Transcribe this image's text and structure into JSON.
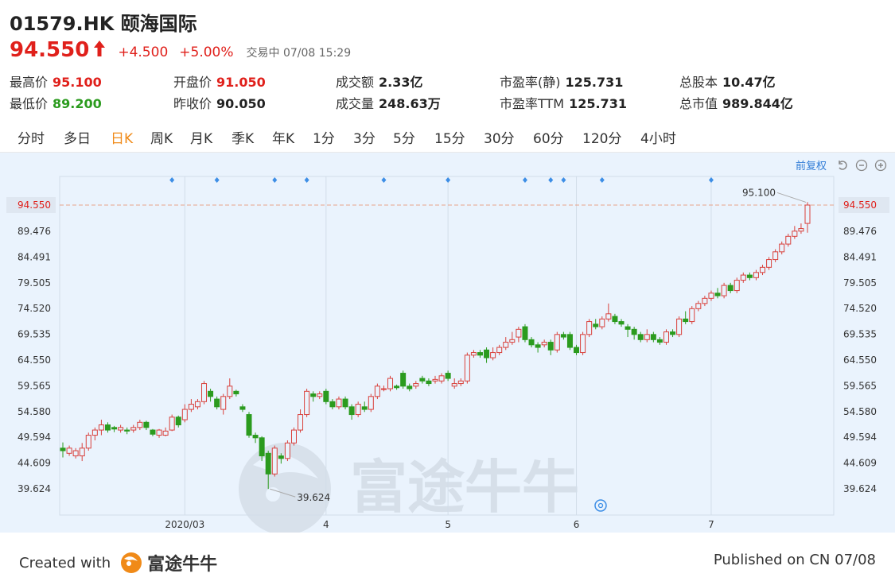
{
  "header": {
    "title": "01579.HK 颐海国际",
    "price": "94.550",
    "change": "+4.500",
    "change_pct": "+5.00%",
    "status": "交易中 07/08 15:29"
  },
  "stats": [
    {
      "label": "最高价",
      "value": "95.100",
      "color": "red"
    },
    {
      "label": "开盘价",
      "value": "91.050",
      "color": "red"
    },
    {
      "label": "成交额",
      "value": "2.33亿",
      "color": ""
    },
    {
      "label": "市盈率(静)",
      "value": "125.731",
      "color": ""
    },
    {
      "label": "总股本",
      "value": "10.47亿",
      "color": ""
    },
    {
      "label": "最低价",
      "value": "89.200",
      "color": "green"
    },
    {
      "label": "昨收价",
      "value": "90.050",
      "color": ""
    },
    {
      "label": "成交量",
      "value": "248.63万",
      "color": ""
    },
    {
      "label": "市盈率TTM",
      "value": "125.731",
      "color": ""
    },
    {
      "label": "总市值",
      "value": "989.844亿",
      "color": ""
    }
  ],
  "tabs": [
    "分时",
    "多日",
    "日K",
    "周K",
    "月K",
    "季K",
    "年K",
    "1分",
    "3分",
    "5分",
    "15分",
    "30分",
    "60分",
    "120分",
    "4小时"
  ],
  "active_tab": "日K",
  "toolbar": {
    "adjust_label": "前复权"
  },
  "watermark": "富途牛牛",
  "footer": {
    "created_label": "Created with",
    "brand": "富途牛牛",
    "published": "Published on CN 07/08"
  },
  "colors": {
    "up": "#d9403b",
    "down": "#2b9b1e",
    "accent": "#f08a18",
    "link": "#2f7bd6",
    "background": "#eaf3fd"
  },
  "chart_data": {
    "type": "candlestick",
    "y_ticks": [
      "94.550",
      "89.476",
      "84.491",
      "79.505",
      "74.520",
      "69.535",
      "64.550",
      "59.565",
      "54.580",
      "49.594",
      "44.609",
      "39.624"
    ],
    "ylim": [
      39.624,
      94.55
    ],
    "x_ticks": [
      {
        "label": "2020/03",
        "index": 19
      },
      {
        "label": "4",
        "index": 41
      },
      {
        "label": "5",
        "index": 60
      },
      {
        "label": "6",
        "index": 80
      },
      {
        "label": "7",
        "index": 101
      }
    ],
    "current_price": "94.550",
    "max_label": "95.100",
    "min_label": "39.624",
    "candles": [
      [
        47.5,
        47.0,
        48.6,
        45.7
      ],
      [
        46.5,
        47.5,
        48.0,
        46.0
      ],
      [
        46.0,
        47.0,
        47.5,
        45.5
      ],
      [
        46.0,
        47.5,
        48.5,
        45.0
      ],
      [
        47.5,
        50.0,
        50.5,
        47.0
      ],
      [
        50.0,
        51.0,
        51.5,
        49.0
      ],
      [
        51.0,
        52.0,
        53.0,
        50.0
      ],
      [
        52.0,
        51.0,
        52.5,
        50.5
      ],
      [
        51.5,
        51.2,
        51.8,
        50.6
      ],
      [
        51.0,
        51.5,
        52.0,
        50.5
      ],
      [
        51.0,
        50.8,
        51.5,
        50.2
      ],
      [
        51.0,
        51.5,
        52.0,
        50.5
      ],
      [
        51.5,
        52.5,
        53.0,
        51.0
      ],
      [
        52.5,
        51.5,
        52.8,
        51.0
      ],
      [
        51.0,
        50.2,
        51.2,
        49.8
      ],
      [
        50.0,
        51.0,
        51.2,
        49.5
      ],
      [
        50.0,
        50.8,
        51.5,
        49.8
      ],
      [
        51.0,
        53.5,
        54.0,
        50.8
      ],
      [
        53.5,
        52.0,
        53.8,
        51.5
      ],
      [
        53.0,
        55.0,
        56.0,
        52.5
      ],
      [
        55.0,
        56.0,
        57.0,
        54.5
      ],
      [
        55.5,
        56.5,
        57.0,
        55.0
      ],
      [
        56.5,
        60.0,
        60.5,
        56.0
      ],
      [
        58.5,
        57.5,
        59.0,
        56.5
      ],
      [
        57.0,
        55.5,
        57.5,
        55.0
      ],
      [
        55.0,
        57.5,
        58.0,
        54.0
      ],
      [
        57.5,
        59.5,
        61.0,
        57.0
      ],
      [
        58.5,
        58.0,
        58.8,
        57.5
      ],
      [
        55.5,
        55.0,
        56.0,
        54.5
      ],
      [
        54.0,
        50.0,
        54.5,
        49.5
      ],
      [
        50.0,
        49.5,
        50.5,
        48.5
      ],
      [
        49.5,
        46.0,
        49.8,
        45.0
      ],
      [
        46.5,
        42.5,
        47.0,
        39.6
      ],
      [
        42.5,
        47.5,
        48.0,
        42.0
      ],
      [
        46.0,
        45.5,
        46.5,
        44.5
      ],
      [
        45.5,
        48.5,
        49.0,
        45.0
      ],
      [
        48.5,
        51.0,
        51.5,
        48.0
      ],
      [
        51.0,
        54.0,
        55.0,
        50.5
      ],
      [
        54.0,
        58.5,
        59.0,
        53.5
      ],
      [
        58.0,
        57.5,
        58.5,
        56.5
      ],
      [
        57.5,
        58.0,
        58.5,
        57.0
      ],
      [
        58.5,
        56.5,
        59.0,
        56.0
      ],
      [
        56.5,
        55.5,
        57.0,
        55.0
      ],
      [
        55.5,
        57.0,
        57.5,
        55.0
      ],
      [
        57.0,
        55.5,
        57.5,
        55.0
      ],
      [
        55.5,
        54.0,
        56.0,
        53.0
      ],
      [
        54.0,
        56.0,
        56.5,
        53.5
      ],
      [
        55.5,
        55.0,
        56.5,
        54.5
      ],
      [
        55.0,
        57.5,
        58.0,
        54.5
      ],
      [
        57.5,
        59.5,
        60.0,
        57.0
      ],
      [
        59.0,
        59.0,
        59.6,
        58.5
      ],
      [
        59.0,
        61.0,
        61.5,
        58.5
      ],
      [
        59.5,
        59.2,
        59.8,
        58.8
      ],
      [
        62.0,
        59.5,
        62.5,
        59.0
      ],
      [
        59.5,
        59.0,
        60.0,
        58.5
      ],
      [
        59.5,
        60.0,
        60.5,
        59.0
      ],
      [
        61.0,
        60.5,
        61.5,
        60.0
      ],
      [
        60.5,
        60.0,
        61.0,
        59.5
      ],
      [
        60.5,
        60.8,
        61.5,
        60.0
      ],
      [
        60.5,
        61.5,
        62.0,
        60.0
      ],
      [
        62.0,
        61.0,
        62.5,
        60.5
      ],
      [
        59.5,
        60.0,
        61.0,
        59.0
      ],
      [
        60.0,
        60.5,
        61.0,
        59.5
      ],
      [
        60.5,
        65.5,
        66.0,
        60.0
      ],
      [
        65.5,
        66.0,
        66.5,
        65.0
      ],
      [
        66.0,
        65.5,
        66.5,
        65.0
      ],
      [
        66.5,
        65.0,
        67.0,
        64.0
      ],
      [
        65.0,
        66.0,
        67.0,
        64.5
      ],
      [
        66.0,
        67.0,
        67.5,
        65.5
      ],
      [
        67.0,
        68.0,
        69.0,
        66.5
      ],
      [
        68.0,
        68.5,
        70.0,
        67.5
      ],
      [
        69.0,
        70.5,
        71.0,
        68.0
      ],
      [
        71.0,
        68.5,
        71.5,
        68.0
      ],
      [
        68.5,
        67.5,
        69.0,
        67.0
      ],
      [
        67.5,
        67.0,
        68.0,
        66.0
      ],
      [
        67.5,
        68.0,
        68.5,
        67.0
      ],
      [
        68.0,
        66.5,
        68.5,
        65.5
      ],
      [
        66.5,
        69.5,
        70.0,
        66.0
      ],
      [
        69.5,
        69.0,
        70.0,
        68.5
      ],
      [
        69.5,
        67.0,
        70.0,
        66.5
      ],
      [
        67.0,
        66.0,
        67.5,
        65.5
      ],
      [
        66.0,
        69.5,
        70.0,
        65.5
      ],
      [
        69.5,
        72.0,
        72.5,
        69.0
      ],
      [
        71.5,
        71.0,
        72.5,
        70.5
      ],
      [
        71.0,
        72.5,
        73.0,
        70.5
      ],
      [
        72.5,
        73.5,
        75.5,
        72.0
      ],
      [
        73.0,
        72.0,
        73.5,
        71.5
      ],
      [
        72.0,
        71.5,
        72.5,
        71.0
      ],
      [
        71.0,
        70.5,
        71.5,
        69.0
      ],
      [
        70.5,
        69.5,
        71.0,
        68.5
      ],
      [
        69.5,
        68.5,
        70.0,
        68.0
      ],
      [
        68.5,
        69.5,
        70.5,
        68.0
      ],
      [
        69.5,
        68.5,
        70.0,
        68.0
      ],
      [
        68.5,
        68.0,
        69.0,
        67.5
      ],
      [
        68.0,
        70.0,
        70.5,
        67.5
      ],
      [
        70.0,
        69.5,
        70.5,
        69.0
      ],
      [
        69.5,
        72.5,
        73.0,
        69.0
      ],
      [
        72.5,
        72.0,
        74.0,
        71.5
      ],
      [
        72.0,
        74.5,
        75.0,
        71.5
      ],
      [
        74.5,
        75.5,
        76.0,
        74.0
      ],
      [
        75.5,
        76.5,
        77.0,
        75.0
      ],
      [
        76.5,
        77.5,
        78.0,
        76.0
      ],
      [
        77.5,
        77.0,
        78.5,
        76.5
      ],
      [
        77.0,
        79.0,
        79.5,
        76.5
      ],
      [
        79.0,
        78.0,
        79.5,
        77.5
      ],
      [
        78.0,
        80.0,
        80.5,
        77.5
      ],
      [
        80.0,
        81.0,
        81.5,
        79.5
      ],
      [
        81.0,
        80.5,
        81.5,
        80.0
      ],
      [
        80.5,
        81.5,
        82.0,
        80.0
      ],
      [
        81.5,
        82.5,
        83.0,
        81.0
      ],
      [
        82.5,
        84.0,
        84.5,
        82.0
      ],
      [
        84.0,
        85.5,
        86.0,
        83.5
      ],
      [
        85.5,
        87.0,
        87.5,
        85.0
      ],
      [
        87.0,
        88.5,
        89.0,
        86.5
      ],
      [
        88.5,
        89.5,
        90.5,
        88.0
      ],
      [
        89.5,
        90.0,
        91.0,
        89.0
      ],
      [
        91.0,
        94.55,
        95.1,
        89.2
      ]
    ]
  }
}
